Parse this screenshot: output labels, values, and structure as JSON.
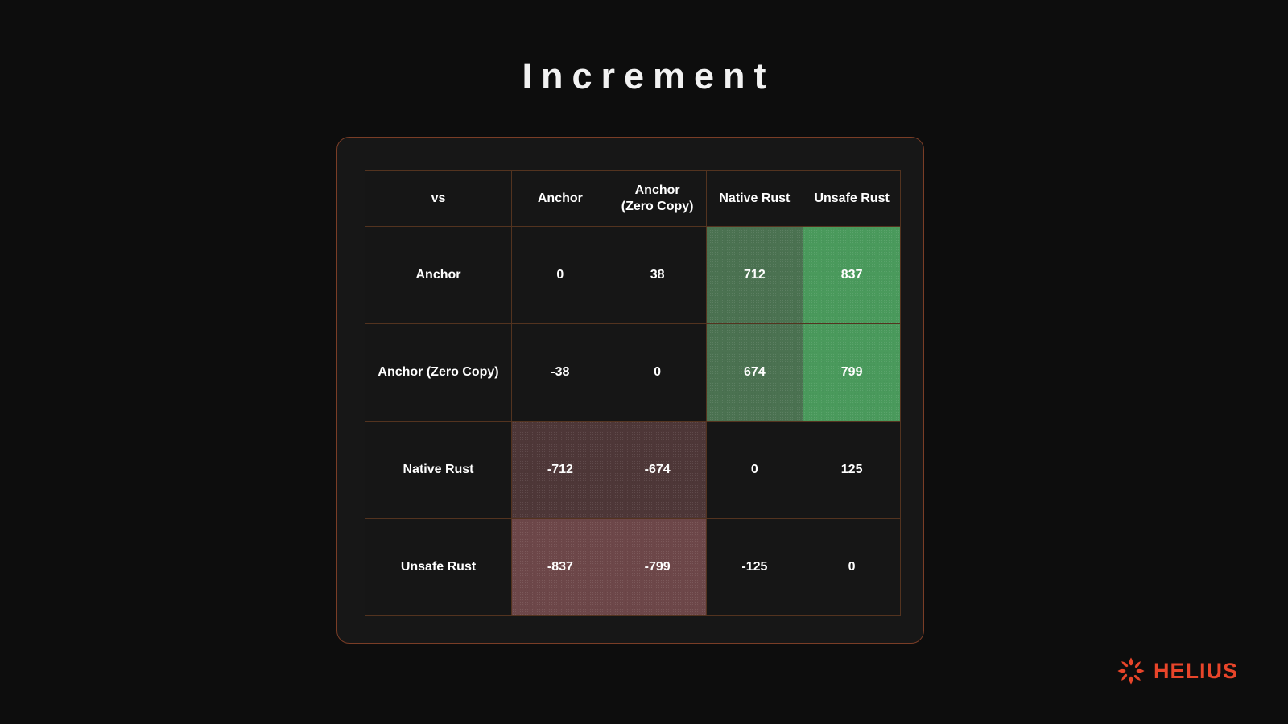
{
  "title": "Increment",
  "brand": {
    "name": "HELIUS",
    "logo_icon": "helius-sun-icon",
    "accent_color": "#e8452a"
  },
  "theme": {
    "background": "#0d0d0d",
    "card_background": "#171717",
    "card_border": "#7a3d26",
    "grid_line": "#53331f",
    "text": "#ffffff",
    "positive_strong": "#4a9a5c",
    "positive_mid": "#4b7251",
    "negative_strong": "#6d4749",
    "negative_mid": "#4e3738"
  },
  "chart_data": {
    "type": "heatmap",
    "title": "Increment",
    "xlabel": "",
    "ylabel": "",
    "corner_label": "vs",
    "categories": [
      "Anchor",
      "Anchor (Zero Copy)",
      "Native Rust",
      "Unsafe Rust"
    ],
    "column_headers": [
      "vs",
      "Anchor",
      "Anchor\n(Zero Copy)",
      "Native Rust",
      "Unsafe Rust"
    ],
    "row_labels": [
      "Anchor",
      "Anchor (Zero Copy)",
      "Native Rust",
      "Unsafe Rust"
    ],
    "values": [
      [
        0,
        38,
        712,
        837
      ],
      [
        -38,
        0,
        674,
        799
      ],
      [
        -712,
        -674,
        0,
        125
      ],
      [
        -837,
        -799,
        -125,
        0
      ]
    ],
    "cell_styles": [
      [
        "neutral",
        "neutral",
        "pos-mid",
        "pos-strong"
      ],
      [
        "neutral",
        "neutral",
        "pos-mid",
        "pos-strong"
      ],
      [
        "neg-mid",
        "neg-mid",
        "neutral",
        "neutral"
      ],
      [
        "neg-strong",
        "neg-strong",
        "neutral",
        "neutral"
      ]
    ],
    "legend": [],
    "annotations": []
  },
  "table": {
    "header": {
      "corner": "vs",
      "col1": "Anchor",
      "col2_line1": "Anchor",
      "col2_line2": "(Zero Copy)",
      "col3": "Native Rust",
      "col4": "Unsafe Rust"
    },
    "rows": [
      {
        "label": "Anchor",
        "cells": [
          {
            "text": "0",
            "style": "neutral"
          },
          {
            "text": "38",
            "style": "neutral"
          },
          {
            "text": "712",
            "style": "pos-mid"
          },
          {
            "text": "837",
            "style": "pos-strong"
          }
        ]
      },
      {
        "label": "Anchor (Zero Copy)",
        "cells": [
          {
            "text": "-38",
            "style": "neutral"
          },
          {
            "text": "0",
            "style": "neutral"
          },
          {
            "text": "674",
            "style": "pos-mid"
          },
          {
            "text": "799",
            "style": "pos-strong"
          }
        ]
      },
      {
        "label": "Native Rust",
        "cells": [
          {
            "text": "-712",
            "style": "neg-mid"
          },
          {
            "text": "-674",
            "style": "neg-mid"
          },
          {
            "text": "0",
            "style": "neutral"
          },
          {
            "text": "125",
            "style": "neutral"
          }
        ]
      },
      {
        "label": "Unsafe Rust",
        "cells": [
          {
            "text": "-837",
            "style": "neg-strong"
          },
          {
            "text": "-799",
            "style": "neg-strong"
          },
          {
            "text": "-125",
            "style": "neutral"
          },
          {
            "text": "0",
            "style": "neutral"
          }
        ]
      }
    ]
  }
}
